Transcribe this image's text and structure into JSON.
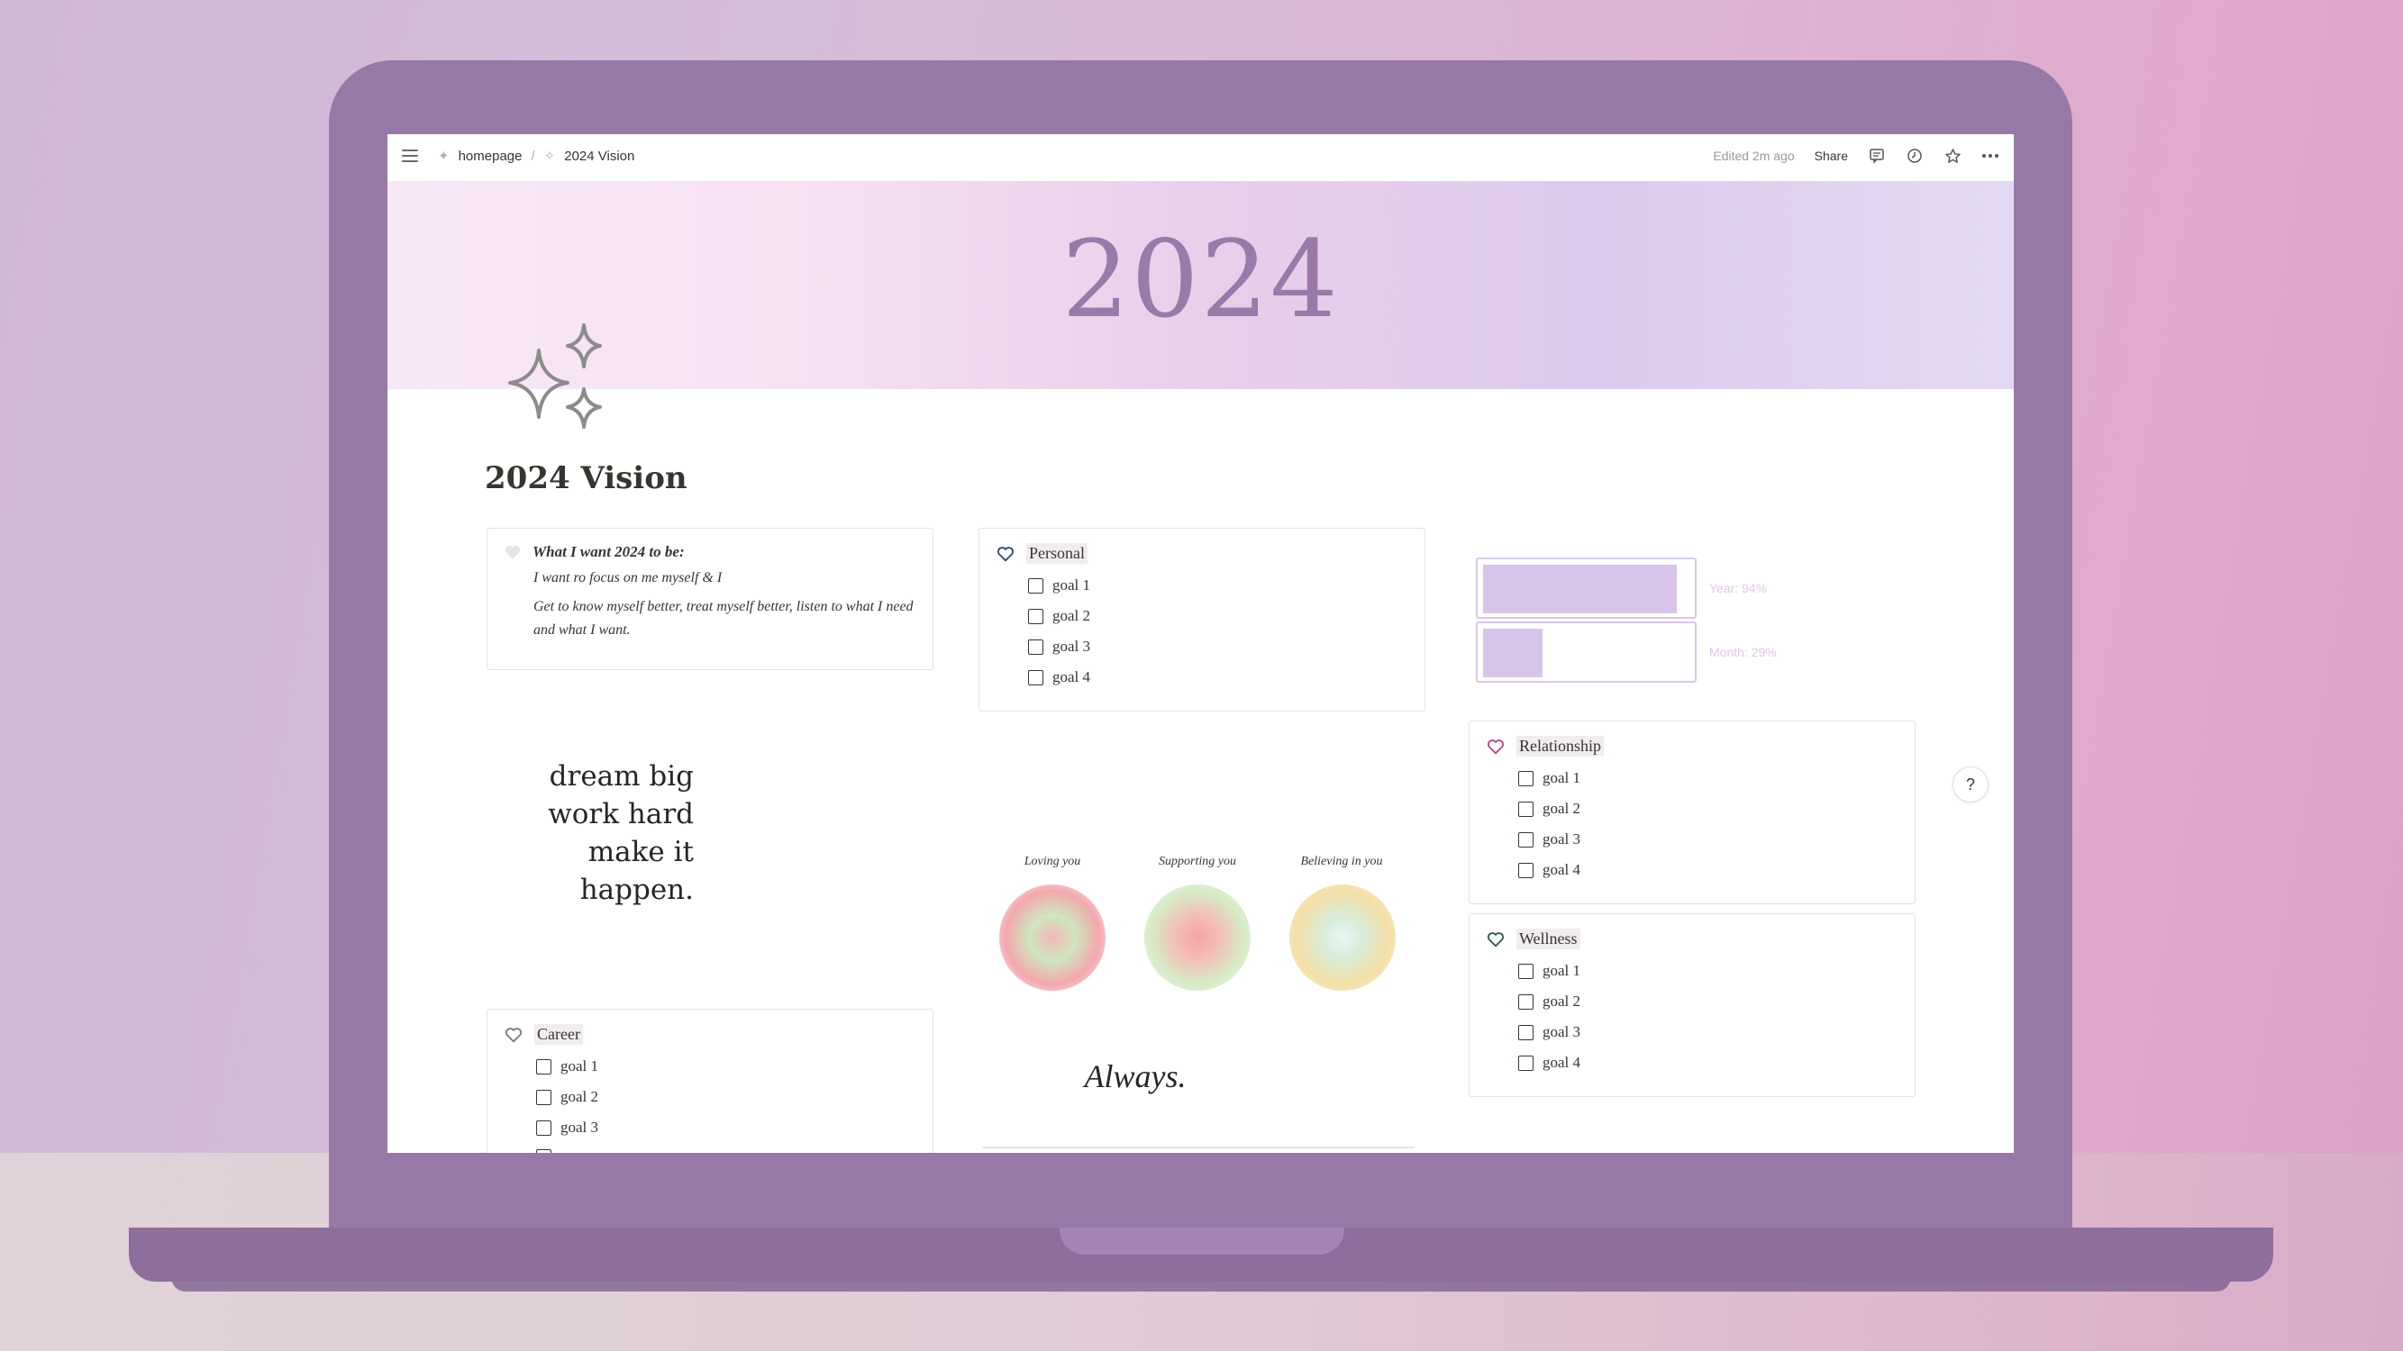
{
  "topbar": {
    "breadcrumb": [
      "homepage",
      "2024 Vision"
    ],
    "separator": "/",
    "edited": "Edited 2m ago",
    "share": "Share"
  },
  "cover": {
    "title": "2024"
  },
  "page": {
    "title": "2024 Vision"
  },
  "vision": {
    "heading": "What I want 2024 to be:",
    "line1": "I want ro focus on me myself & I",
    "line2": "Get to know myself better, treat myself better, listen to what I need and what I want."
  },
  "quote": [
    "dream big",
    "work hard",
    "make it",
    "happen."
  ],
  "sections": {
    "personal": {
      "title": "Personal",
      "goals": [
        "goal 1",
        "goal 2",
        "goal 3",
        "goal 4"
      ]
    },
    "career": {
      "title": "Career",
      "goals": [
        "goal 1",
        "goal 2",
        "goal 3"
      ]
    },
    "relationship": {
      "title": "Relationship",
      "goals": [
        "goal 1",
        "goal 2",
        "goal 3",
        "goal 4"
      ]
    },
    "wellness": {
      "title": "Wellness",
      "goals": [
        "goal 1",
        "goal 2",
        "goal 3",
        "goal 4"
      ]
    }
  },
  "orbs": [
    {
      "label": "Loving you"
    },
    {
      "label": "Supporting you"
    },
    {
      "label": "Believing in you"
    }
  ],
  "always": "Always.",
  "progress": {
    "year": {
      "label": "Year: 94%",
      "value": 0.94
    },
    "month": {
      "label": "Month: 29%",
      "value": 0.29
    }
  },
  "help": "?",
  "colors": {
    "accent": "#9a7aa9",
    "laptop": "#9779a7",
    "bar": "#d8c4e8"
  }
}
